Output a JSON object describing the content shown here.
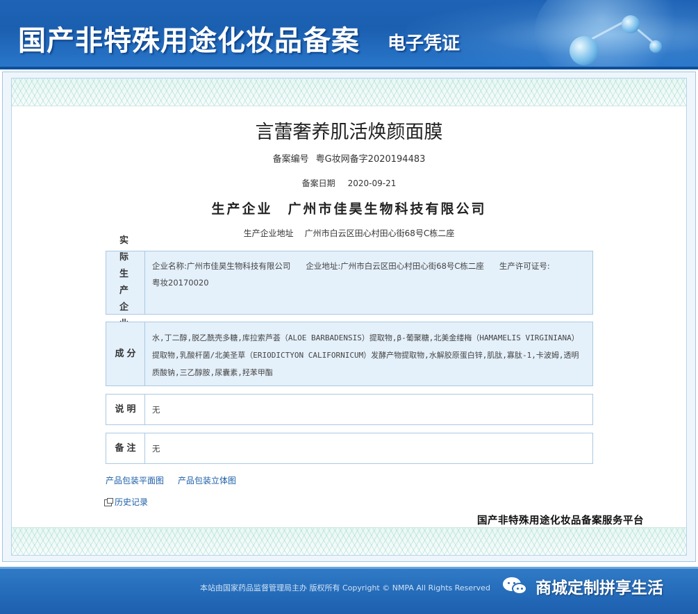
{
  "header": {
    "title": "国产非特殊用途化妆品备案",
    "subtitle": "电子凭证"
  },
  "product": {
    "name": "言蕾奢养肌活焕颜面膜",
    "record_number_label": "备案编号",
    "record_number": "粤G妆网备字2020194483",
    "record_date_label": "备案日期",
    "record_date": "2020-09-21",
    "manufacturer_label": "生产企业",
    "manufacturer": "广州市佳昊生物科技有限公司",
    "address_label": "生产企业地址",
    "address": "广州市白云区田心村田心街68号C栋二座"
  },
  "sections": {
    "actual_producer": {
      "label": "实际生产企业",
      "name_label": "企业名称:",
      "name": "广州市佳昊生物科技有限公司",
      "address_label": "企业地址:",
      "address": "广州市白云区田心村田心街68号C栋二座",
      "license_label": "生产许可证号:",
      "license": "粤妆20170020"
    },
    "ingredients": {
      "label": "成分",
      "text": "水,丁二醇,脱乙酰壳多糖,库拉索芦荟（ALOE BARBADENSIS）提取物,β-葡聚糖,北美金缕梅（HAMAMELIS VIRGINIANA）提取物,乳酸杆菌/北美圣草（ERIODICTYON CALIFORNICUM）发酵产物提取物,水解胶原蛋白锌,肌肽,寡肽-1,卡波姆,透明质酸钠,三乙醇胺,尿囊素,羟苯甲酯"
    },
    "description": {
      "label": "说明",
      "value": "无"
    },
    "remarks": {
      "label": "备注",
      "value": "无"
    }
  },
  "links": {
    "package_flat": "产品包装平面图",
    "package_3d": "产品包装立体图",
    "history": "历史记录"
  },
  "platform": "国产非特殊用途化妆品备案服务平台",
  "footer": {
    "copyright": "本站由国家药品监督管理局主办 版权所有 Copyright © NMPA All Rights Reserved",
    "watermark": "商城定制拼享生活",
    "watermark_icon": "wechat-icon"
  },
  "colors": {
    "header_blue": "#1e63b6",
    "link_blue": "#1a5ea8",
    "section_highlight": "#e4f0fa",
    "footer_blue": "#1c5fae"
  }
}
